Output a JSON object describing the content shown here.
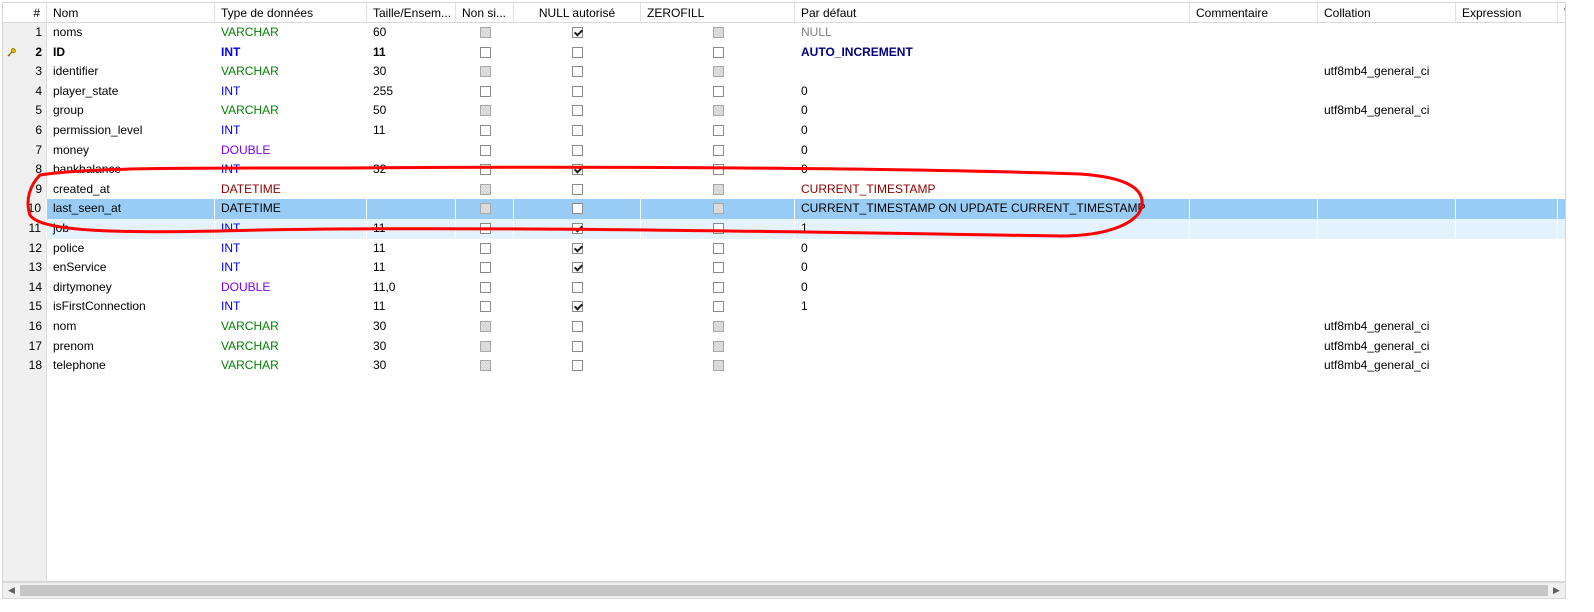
{
  "headers": {
    "num": "#",
    "name": "Nom",
    "type": "Type de données",
    "length": "Taille/Ensem...",
    "unsigned": "Non si...",
    "nullable": "NULL autorisé",
    "zerofill": "ZEROFILL",
    "default": "Par défaut",
    "comment": "Commentaire",
    "collation": "Collation",
    "expression": "Expression",
    "virtual": "V"
  },
  "rows": [
    {
      "num": "1",
      "name": "noms",
      "type": "VARCHAR",
      "tclass": "varchar",
      "length": "60",
      "unsigned": "dis",
      "nullable": "on",
      "zerofill": "dis",
      "default": "NULL",
      "dclass": "null",
      "collation": ""
    },
    {
      "num": "2",
      "name": "ID",
      "type": "INT",
      "tclass": "int",
      "length": "11",
      "unsigned": "off",
      "nullable": "off",
      "zerofill": "off",
      "default": "AUTO_INCREMENT",
      "dclass": "auto",
      "collation": "",
      "bold": true,
      "key": true
    },
    {
      "num": "3",
      "name": "identifier",
      "type": "VARCHAR",
      "tclass": "varchar",
      "length": "30",
      "unsigned": "dis",
      "nullable": "off",
      "zerofill": "dis",
      "default": "",
      "dclass": "",
      "collation": "utf8mb4_general_ci"
    },
    {
      "num": "4",
      "name": "player_state",
      "type": "INT",
      "tclass": "int",
      "length": "255",
      "unsigned": "off",
      "nullable": "off",
      "zerofill": "off",
      "default": "0",
      "dclass": "",
      "collation": ""
    },
    {
      "num": "5",
      "name": "group",
      "type": "VARCHAR",
      "tclass": "varchar",
      "length": "50",
      "unsigned": "dis",
      "nullable": "off",
      "zerofill": "dis",
      "default": "0",
      "dclass": "",
      "collation": "utf8mb4_general_ci"
    },
    {
      "num": "6",
      "name": "permission_level",
      "type": "INT",
      "tclass": "int",
      "length": "11",
      "unsigned": "off",
      "nullable": "off",
      "zerofill": "off",
      "default": "0",
      "dclass": "",
      "collation": ""
    },
    {
      "num": "7",
      "name": "money",
      "type": "DOUBLE",
      "tclass": "double",
      "length": "",
      "unsigned": "off",
      "nullable": "off",
      "zerofill": "off",
      "default": "0",
      "dclass": "",
      "collation": ""
    },
    {
      "num": "8",
      "name": "bankbalance",
      "type": "INT",
      "tclass": "int",
      "length": "32",
      "unsigned": "off",
      "nullable": "on",
      "zerofill": "off",
      "default": "0",
      "dclass": "",
      "collation": ""
    },
    {
      "num": "9",
      "name": "created_at",
      "type": "DATETIME",
      "tclass": "datetime",
      "length": "",
      "unsigned": "dis",
      "nullable": "off",
      "zerofill": "dis",
      "default": "CURRENT_TIMESTAMP",
      "dclass": "ts",
      "collation": ""
    },
    {
      "num": "10",
      "name": "last_seen_at",
      "type": "DATETIME",
      "tclass": "datetime",
      "length": "",
      "unsigned": "dis",
      "nullable": "off",
      "zerofill": "dis",
      "default": "CURRENT_TIMESTAMP ON UPDATE CURRENT_TIMESTAMP",
      "dclass": "ts",
      "collation": "",
      "state": "selected"
    },
    {
      "num": "11",
      "name": "job",
      "type": "INT",
      "tclass": "int",
      "length": "11",
      "unsigned": "off",
      "nullable": "on",
      "zerofill": "off",
      "default": "1",
      "dclass": "",
      "collation": "",
      "state": "ghost"
    },
    {
      "num": "12",
      "name": "police",
      "type": "INT",
      "tclass": "int",
      "length": "11",
      "unsigned": "off",
      "nullable": "on",
      "zerofill": "off",
      "default": "0",
      "dclass": "",
      "collation": ""
    },
    {
      "num": "13",
      "name": "enService",
      "type": "INT",
      "tclass": "int",
      "length": "11",
      "unsigned": "off",
      "nullable": "on",
      "zerofill": "off",
      "default": "0",
      "dclass": "",
      "collation": ""
    },
    {
      "num": "14",
      "name": "dirtymoney",
      "type": "DOUBLE",
      "tclass": "double",
      "length": "11,0",
      "unsigned": "off",
      "nullable": "off",
      "zerofill": "off",
      "default": "0",
      "dclass": "",
      "collation": ""
    },
    {
      "num": "15",
      "name": "isFirstConnection",
      "type": "INT",
      "tclass": "int",
      "length": "11",
      "unsigned": "off",
      "nullable": "on",
      "zerofill": "off",
      "default": "1",
      "dclass": "",
      "collation": ""
    },
    {
      "num": "16",
      "name": "nom",
      "type": "VARCHAR",
      "tclass": "varchar",
      "length": "30",
      "unsigned": "dis",
      "nullable": "off",
      "zerofill": "dis",
      "default": "",
      "dclass": "",
      "collation": "utf8mb4_general_ci"
    },
    {
      "num": "17",
      "name": "prenom",
      "type": "VARCHAR",
      "tclass": "varchar",
      "length": "30",
      "unsigned": "dis",
      "nullable": "off",
      "zerofill": "dis",
      "default": "",
      "dclass": "",
      "collation": "utf8mb4_general_ci"
    },
    {
      "num": "18",
      "name": "telephone",
      "type": "VARCHAR",
      "tclass": "varchar",
      "length": "30",
      "unsigned": "dis",
      "nullable": "off",
      "zerofill": "dis",
      "default": "",
      "dclass": "",
      "collation": "utf8mb4_general_ci"
    }
  ],
  "icons": {
    "primary_key": "key-icon",
    "scroll_left": "arrow-left-icon",
    "scroll_right": "arrow-right-icon"
  },
  "colors": {
    "selected_row": "#99ccf5",
    "annotation": "#ff0000",
    "varchar": "#008000",
    "int": "#0000ff",
    "double": "#7b00ff",
    "datetime": "#8b0000"
  }
}
